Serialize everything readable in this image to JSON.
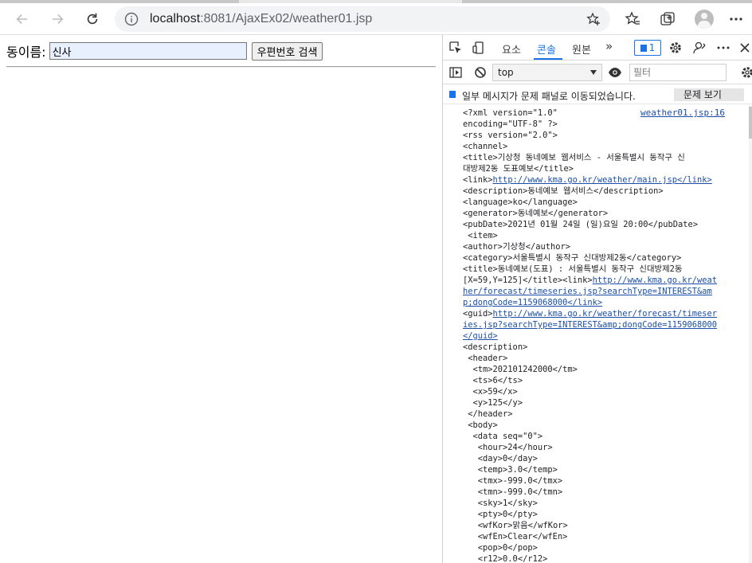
{
  "browser": {
    "url_host": "localhost",
    "url_rest": ":8081/AjaxEx02/weather01.jsp"
  },
  "page": {
    "dong_label": "동이름:",
    "dong_value": "신사",
    "search_button": "우편번호 검색"
  },
  "devtools": {
    "tabs": [
      "요소",
      "콘솔",
      "원본"
    ],
    "more": "»",
    "message_count": "1",
    "context": "top",
    "filter_placeholder": "필터",
    "issues_text": "일부 메시지가 문제 패널로 이동되었습니다.",
    "issues_button": "문제 보기",
    "source_link": "weather01.jsp:16",
    "console_lines": [
      {
        "t": "<?xml version=\"1.0\""
      },
      {
        "t": "encoding=\"UTF-8\" ?>"
      },
      {
        "t": "<rss version=\"2.0\">"
      },
      {
        "t": "<channel>"
      },
      {
        "t": "<title>기상청 동네예보 웹서비스 - 서울특별시 동작구 신"
      },
      {
        "t": "대방제2동 도표예보</title>"
      },
      {
        "t": "<link>",
        "a": "http://www.kma.go.kr/weather/main.jsp</link>"
      },
      {
        "t": "<description>동네예보 웹서비스</description>"
      },
      {
        "t": "<language>ko</language>"
      },
      {
        "t": "<generator>동네예보</generator>"
      },
      {
        "t": "<pubDate>2021년 01월 24일 (일)요일 20:00</pubDate>"
      },
      {
        "t": " <item>"
      },
      {
        "t": "<author>기상청</author>"
      },
      {
        "t": "<category>서울특별시 동작구 신대방제2동</category>"
      },
      {
        "t": "<title>동네예보(도표) : 서울특별시 동작구 신대방제2동"
      },
      {
        "t": "[X=59,Y=125]</title><link>",
        "a": "http://www.kma.go.kr/weat"
      },
      {
        "t": "",
        "a": "her/forecast/timeseries.jsp?searchType=INTEREST&am"
      },
      {
        "t": "",
        "a": "p;dongCode=1159068000</link>"
      },
      {
        "t": "<guid>",
        "a": "http://www.kma.go.kr/weather/forecast/timeser"
      },
      {
        "t": "",
        "a": "ies.jsp?searchType=INTEREST&amp;dongCode=1159068000"
      },
      {
        "t": "",
        "a": "</guid>"
      },
      {
        "t": "<description>"
      },
      {
        "t": " <header>"
      },
      {
        "t": "  <tm>202101242000</tm>"
      },
      {
        "t": "  <ts>6</ts>"
      },
      {
        "t": "  <x>59</x>"
      },
      {
        "t": "  <y>125</y>"
      },
      {
        "t": " </header>"
      },
      {
        "t": " <body>"
      },
      {
        "t": "  <data seq=\"0\">"
      },
      {
        "t": "   <hour>24</hour>"
      },
      {
        "t": "   <day>0</day>"
      },
      {
        "t": "   <temp>3.0</temp>"
      },
      {
        "t": "   <tmx>-999.0</tmx>"
      },
      {
        "t": "   <tmn>-999.0</tmn>"
      },
      {
        "t": "   <sky>1</sky>"
      },
      {
        "t": "   <pty>0</pty>"
      },
      {
        "t": "   <wfKor>맑음</wfKor>"
      },
      {
        "t": "   <wfEn>Clear</wfEn>"
      },
      {
        "t": "   <pop>0</pop>"
      },
      {
        "t": "   <r12>0.0</r12>"
      }
    ]
  }
}
